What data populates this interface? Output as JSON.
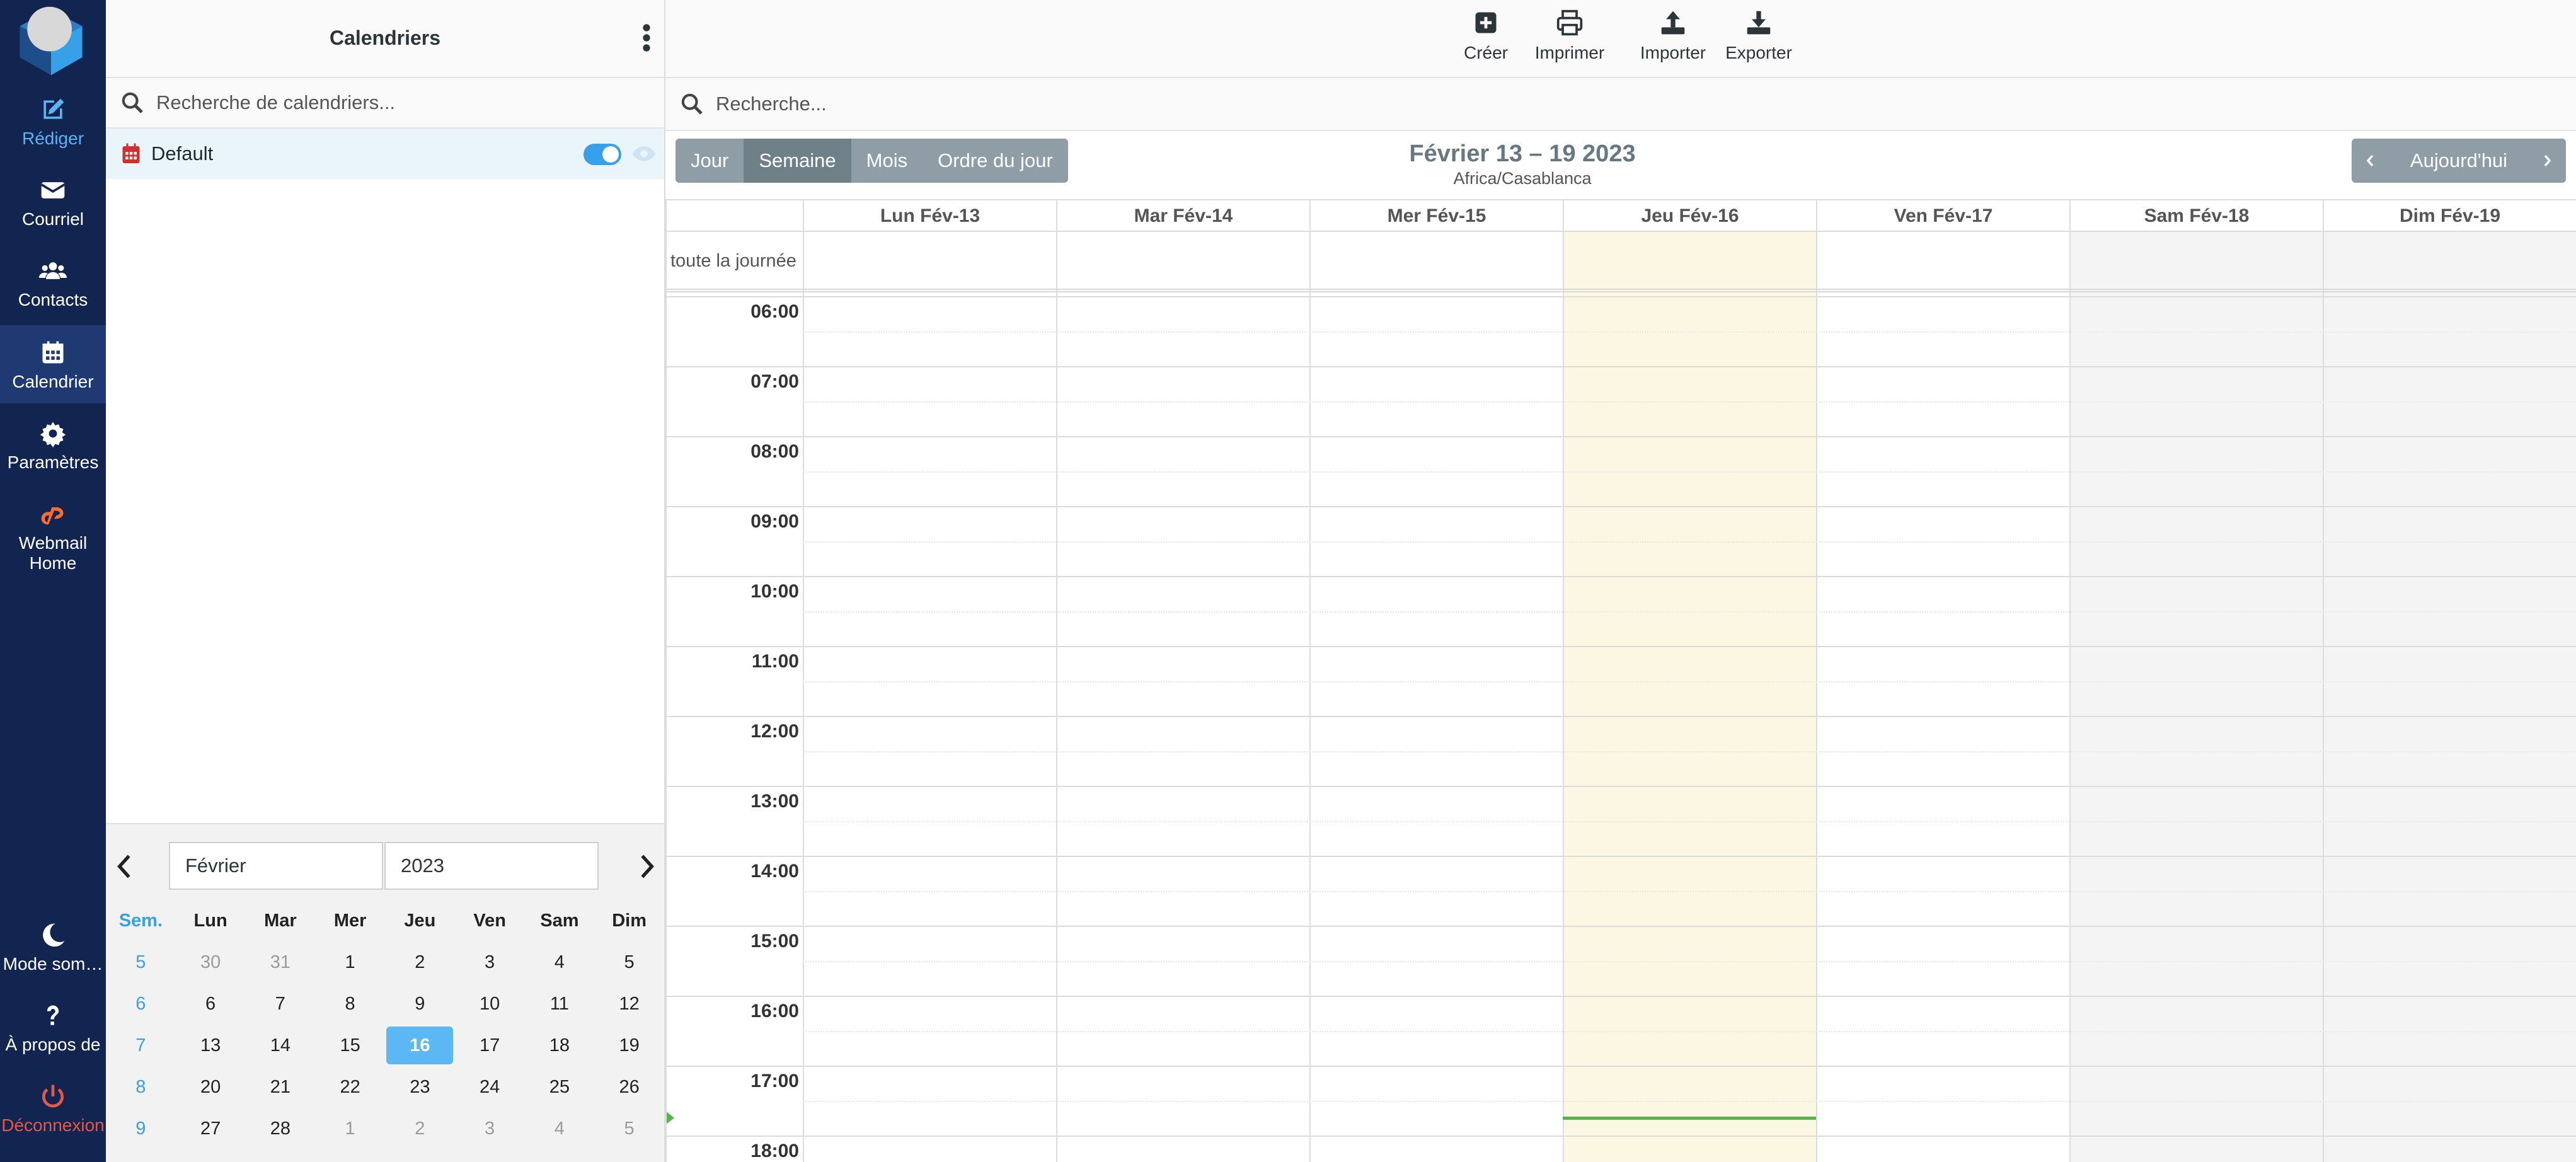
{
  "nav": {
    "items": [
      {
        "key": "compose",
        "label": "Rédiger",
        "icon": "compose-icon"
      },
      {
        "key": "mail",
        "label": "Courriel",
        "icon": "envelope-icon"
      },
      {
        "key": "contacts",
        "label": "Contacts",
        "icon": "users-icon"
      },
      {
        "key": "calendar",
        "label": "Calendrier",
        "icon": "calendar-icon"
      },
      {
        "key": "settings",
        "label": "Paramètres",
        "icon": "gear-icon"
      },
      {
        "key": "webmail",
        "label": "Webmail Home",
        "icon": "cpanel-icon"
      },
      {
        "key": "darkmode",
        "label": "Mode som…",
        "icon": "moon-icon"
      },
      {
        "key": "about",
        "label": "À propos de",
        "icon": "question-icon"
      },
      {
        "key": "logout",
        "label": "Déconnexion",
        "icon": "power-icon"
      }
    ]
  },
  "calendars": {
    "header_title": "Calendriers",
    "search_placeholder": "Recherche de calendriers...",
    "items": [
      {
        "name": "Default",
        "enabled": true
      }
    ]
  },
  "mini_calendar": {
    "month": "Février",
    "year": "2023",
    "headers": [
      "Sem.",
      "Lun",
      "Mar",
      "Mer",
      "Jeu",
      "Ven",
      "Sam",
      "Dim"
    ],
    "weeks": [
      {
        "wk": "5",
        "days": [
          "30",
          "31",
          "1",
          "2",
          "3",
          "4",
          "5"
        ],
        "other": [
          true,
          true,
          false,
          false,
          false,
          false,
          false
        ]
      },
      {
        "wk": "6",
        "days": [
          "6",
          "7",
          "8",
          "9",
          "10",
          "11",
          "12"
        ],
        "other": [
          false,
          false,
          false,
          false,
          false,
          false,
          false
        ]
      },
      {
        "wk": "7",
        "days": [
          "13",
          "14",
          "15",
          "16",
          "17",
          "18",
          "19"
        ],
        "other": [
          false,
          false,
          false,
          false,
          false,
          false,
          false
        ]
      },
      {
        "wk": "8",
        "days": [
          "20",
          "21",
          "22",
          "23",
          "24",
          "25",
          "26"
        ],
        "other": [
          false,
          false,
          false,
          false,
          false,
          false,
          false
        ]
      },
      {
        "wk": "9",
        "days": [
          "27",
          "28",
          "1",
          "2",
          "3",
          "4",
          "5"
        ],
        "other": [
          false,
          false,
          true,
          true,
          true,
          true,
          true
        ]
      }
    ],
    "today": "16"
  },
  "toolbar": {
    "create": "Créer",
    "print": "Imprimer",
    "import": "Importer",
    "export": "Exporter"
  },
  "main_search": {
    "placeholder": "Recherche..."
  },
  "views": {
    "day": "Jour",
    "week": "Semaine",
    "month": "Mois",
    "agenda": "Ordre du jour",
    "selected": "week"
  },
  "period": {
    "title": "Février 13 – 19 2023",
    "timezone": "Africa/Casablanca"
  },
  "navigation": {
    "today": "Aujourd'hui"
  },
  "week": {
    "all_day_label": "toute la journée",
    "days": [
      "Lun Fév-13",
      "Mar Fév-14",
      "Mer Fév-15",
      "Jeu Fév-16",
      "Ven Fév-17",
      "Sam Fév-18",
      "Dim Fév-19"
    ],
    "today_index": 3,
    "weekend_indices": [
      5,
      6
    ],
    "hours": [
      "06:00",
      "07:00",
      "08:00",
      "09:00",
      "10:00",
      "11:00",
      "12:00",
      "13:00",
      "14:00",
      "15:00",
      "16:00",
      "17:00",
      "18:00"
    ],
    "now_time": "17:45"
  },
  "colors": {
    "nav_bg": "#122450",
    "accent": "#37a0e8",
    "today_bg": "#fcf7e3",
    "now_line": "#58b34a",
    "logout": "#e2594b"
  }
}
